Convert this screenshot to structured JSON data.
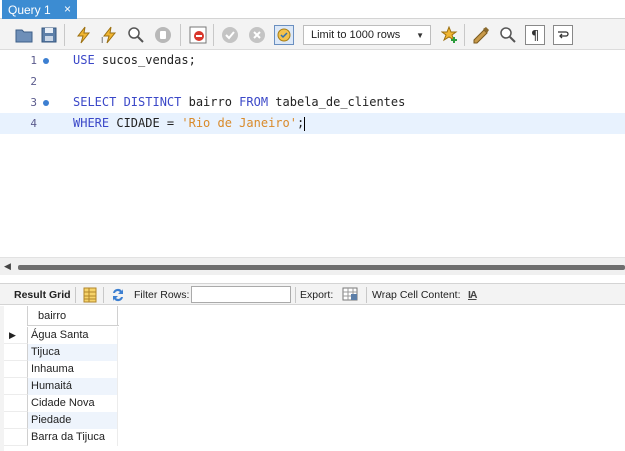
{
  "tab": {
    "title": "Query 1",
    "close": "×"
  },
  "toolbar": {
    "limit_select": "Limit to 1000 rows",
    "icons": [
      "open-folder-icon",
      "save-icon",
      "execute-icon",
      "execute-selection-icon",
      "explain-icon",
      "stop-icon",
      "toggle-error-icon",
      "commit-icon",
      "rollback-icon",
      "autocommit-icon",
      "favorite-snippet-icon",
      "beautify-icon",
      "find-icon",
      "invisible-chars-icon",
      "wrap-icon"
    ]
  },
  "editor": {
    "lines": [
      {
        "num": "1",
        "parts": [
          "USE",
          " sucos_vendas;"
        ]
      },
      {
        "num": "2",
        "parts": []
      },
      {
        "num": "3",
        "parts": [
          "SELECT DISTINCT",
          " bairro ",
          "FROM",
          " tabela_de_clientes"
        ]
      },
      {
        "num": "4",
        "parts": [
          "WHERE",
          " CIDADE = ",
          "'Rio de Janeiro'",
          ";"
        ]
      }
    ]
  },
  "resultbar": {
    "result_grid": "Result Grid",
    "filter_rows": "Filter Rows:",
    "filter_value": "",
    "export": "Export:",
    "wrap_cell": "Wrap Cell Content:",
    "wrap_icon_label": "IA"
  },
  "grid": {
    "columns": [
      "bairro"
    ],
    "rows": [
      "Água Santa",
      "Tijuca",
      "Inhauma",
      "Humaitá",
      "Cidade Nova",
      "Piedade",
      "Barra da Tijuca"
    ]
  },
  "colors": {
    "tab_active": "#3c8cd2",
    "keyword": "#3b48c8",
    "string": "#d98a2a",
    "active_line": "#e8f2fe"
  }
}
